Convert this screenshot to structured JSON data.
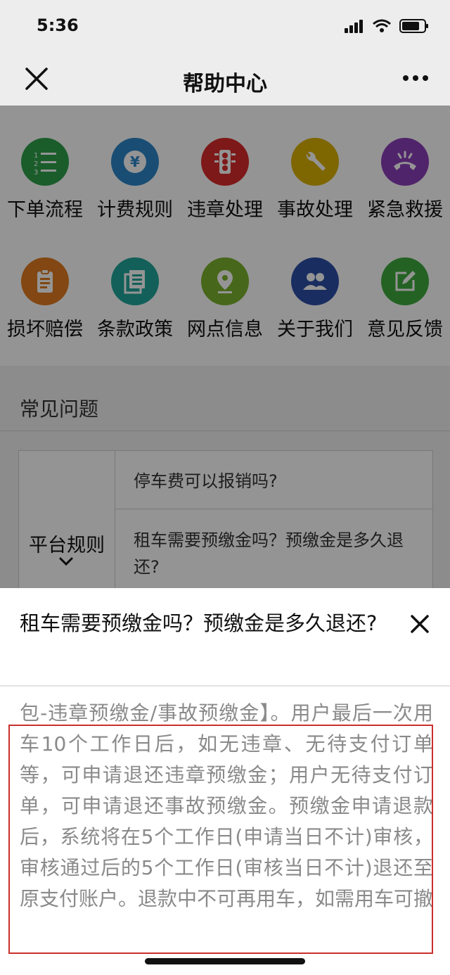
{
  "status_bar": {
    "time": "5:36"
  },
  "nav": {
    "title": "帮助中心",
    "close_icon": "close-icon",
    "more_icon": "more-icon"
  },
  "grid": {
    "items": [
      {
        "label": "下单流程",
        "icon": "order-flow-icon",
        "color": "#2ea04a"
      },
      {
        "label": "计费规则",
        "icon": "billing-yen-icon",
        "color": "#2b86c8"
      },
      {
        "label": "违章处理",
        "icon": "traffic-light-icon",
        "color": "#d92b2b"
      },
      {
        "label": "事故处理",
        "icon": "wrench-icon",
        "color": "#d9b000"
      },
      {
        "label": "紧急救援",
        "icon": "emergency-phone-icon",
        "color": "#8a3fb8"
      },
      {
        "label": "损坏赔偿",
        "icon": "clipboard-icon",
        "color": "#e07a1f"
      },
      {
        "label": "条款政策",
        "icon": "document-list-icon",
        "color": "#1fa69a"
      },
      {
        "label": "网点信息",
        "icon": "location-pin-icon",
        "color": "#7bb12e"
      },
      {
        "label": "关于我们",
        "icon": "people-icon",
        "color": "#2b4fa8"
      },
      {
        "label": "意见反馈",
        "icon": "edit-feedback-icon",
        "color": "#3faa3f"
      }
    ]
  },
  "faq": {
    "title": "常见问题",
    "category": "平台规则",
    "questions": [
      "停车费可以报销吗?",
      "租车需要预缴金吗？预缴金是多久退还?"
    ]
  },
  "sheet": {
    "title": "租车需要预缴金吗？预缴金是多久退还?",
    "body": "包-违章预缴金/事故预缴金】。用户最后一次用车10个工作日后，如无违章、无待支付订单等，可申请退还违章预缴金；用户无待支付订单，可申请退还事故预缴金。预缴金申请退款后，系统将在5个工作日(申请当日不计)审核，审核通过后的5个工作日(审核当日不计)退还至原支付账户。退款中不可再用车，如需用车可撤",
    "highlight_color": "#c9302c"
  }
}
